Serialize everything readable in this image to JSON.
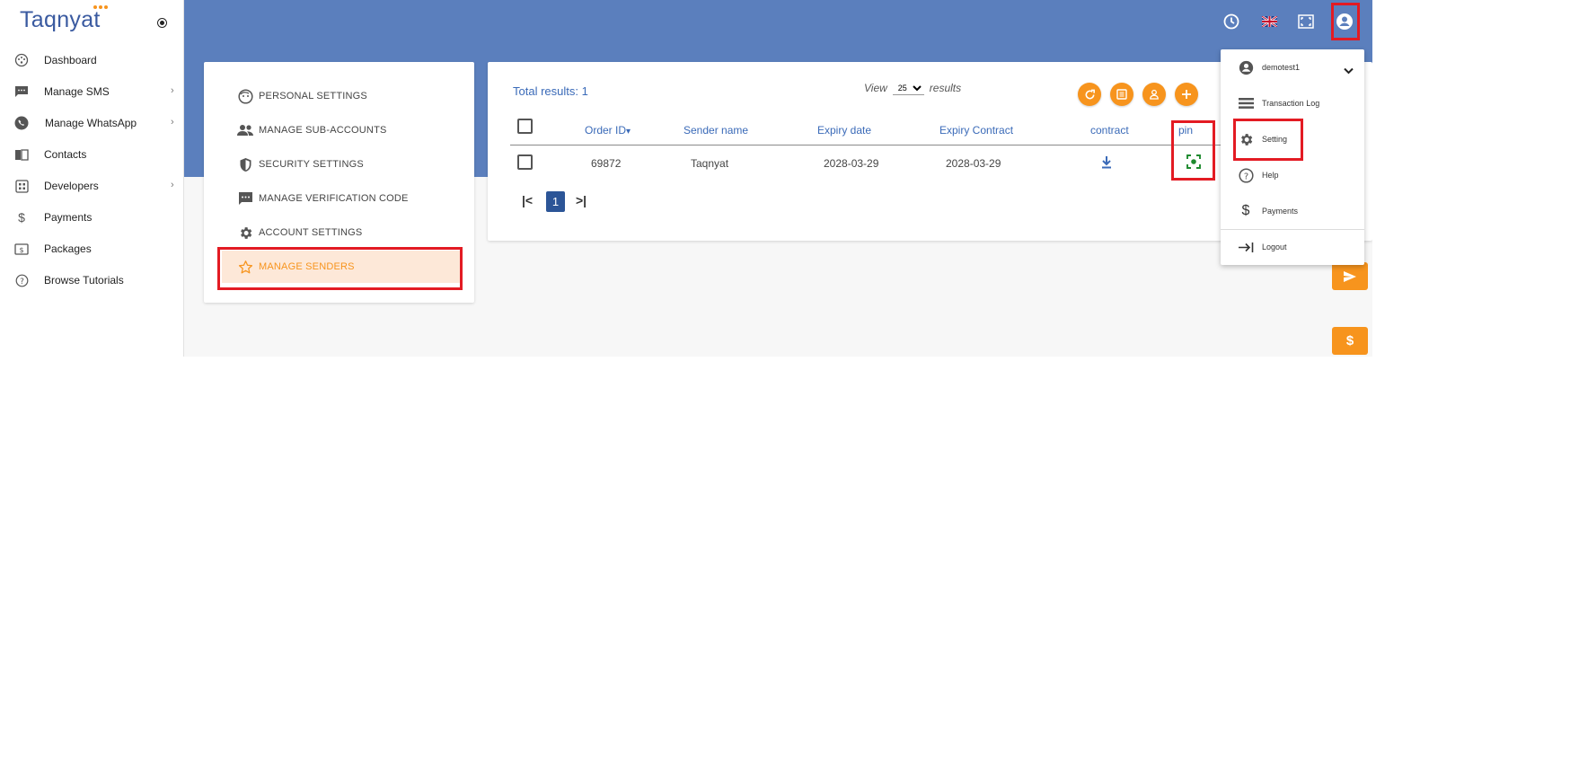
{
  "app": {
    "logo_text": "Taqnyat"
  },
  "sidebar": {
    "items": [
      {
        "label": "Dashboard",
        "icon": "dashboard-icon",
        "has_submenu": false
      },
      {
        "label": "Manage SMS",
        "icon": "sms-icon",
        "has_submenu": true
      },
      {
        "label": "Manage WhatsApp",
        "icon": "whatsapp-icon",
        "has_submenu": true
      },
      {
        "label": "Contacts",
        "icon": "contacts-icon",
        "has_submenu": false
      },
      {
        "label": "Developers",
        "icon": "developers-icon",
        "has_submenu": true
      },
      {
        "label": "Payments",
        "icon": "dollar-icon",
        "has_submenu": false
      },
      {
        "label": "Packages",
        "icon": "packages-icon",
        "has_submenu": false
      },
      {
        "label": "Browse Tutorials",
        "icon": "help-icon",
        "has_submenu": false
      }
    ]
  },
  "header": {
    "icons": [
      "clock-icon",
      "uk-flag-icon",
      "fullscreen-icon",
      "user-account-icon"
    ]
  },
  "settings_menu": {
    "items": [
      {
        "label": "PERSONAL SETTINGS",
        "icon": "face-icon",
        "active": false
      },
      {
        "label": "MANAGE SUB-ACCOUNTS",
        "icon": "people-icon",
        "active": false
      },
      {
        "label": "SECURITY SETTINGS",
        "icon": "shield-icon",
        "active": false
      },
      {
        "label": "MANAGE VERIFICATION CODE",
        "icon": "message-dots-icon",
        "active": false
      },
      {
        "label": "ACCOUNT SETTINGS",
        "icon": "gear-icon",
        "active": false
      },
      {
        "label": "MANAGE SENDERS",
        "icon": "star-icon",
        "active": true
      }
    ]
  },
  "table": {
    "total_label": "Total results: 1",
    "view_prefix": "View",
    "view_suffix": "results",
    "page_size": "25",
    "page_size_options": [
      "25"
    ],
    "actions": [
      "refresh-icon",
      "list-icon",
      "person-icon",
      "add-icon"
    ],
    "columns": [
      "Order ID",
      "Sender name",
      "Expiry date",
      "Expiry Contract",
      "contract",
      "pin"
    ],
    "sort_indicator": "▾",
    "rows": [
      {
        "order_id": "69872",
        "sender_name": "Taqnyat",
        "expiry_date": "2028-03-29",
        "expiry_contract": "2028-03-29"
      }
    ],
    "pagination": {
      "first": "|<",
      "current": "1",
      "last": ">|"
    }
  },
  "user_dropdown": {
    "username": "demotest1",
    "items": [
      {
        "label": "Transaction Log",
        "icon": "list-icon"
      },
      {
        "label": "Setting",
        "icon": "gear-icon"
      },
      {
        "label": "Help",
        "icon": "help-icon"
      },
      {
        "label": "Payments",
        "icon": "dollar-icon"
      },
      {
        "label": "Logout",
        "icon": "logout-icon"
      }
    ]
  },
  "floating_buttons": [
    "send-icon",
    "dollar-icon"
  ],
  "colors": {
    "header": "#5b7fbd",
    "accent": "#f7941d",
    "link": "#3a6ab8",
    "pagination_active": "#2c5597",
    "highlight_box": "#e31b23",
    "pin_icon": "#1e8a2e"
  }
}
